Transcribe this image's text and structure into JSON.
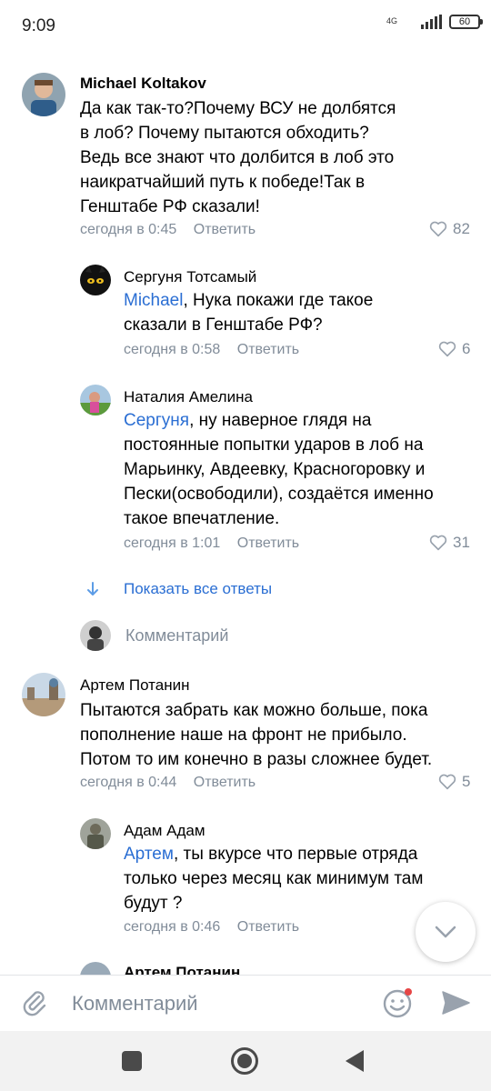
{
  "status_bar": {
    "time": "9:09",
    "network": "4G",
    "battery": "60"
  },
  "comments": [
    {
      "author": "Michael Koltakov",
      "lines": [
        "Да как так-то?Почему ВСУ не долбятся",
        "в лоб? Почему пытаются обходить?",
        "Ведь все знают что долбится в лоб это",
        "наикратчайший путь к победе!Так в",
        "Генштабе РФ сказали!"
      ],
      "time": "сегодня в 0:45",
      "reply_label": "Ответить",
      "likes": "82"
    },
    {
      "author": "Сергуня Тотсамый",
      "mention": "Michael",
      "lines": [
        ", Нука покажи где такое",
        "сказали в Генштабе РФ?"
      ],
      "time": "сегодня в 0:58",
      "reply_label": "Ответить",
      "likes": "6"
    },
    {
      "author": "Наталия Амелина",
      "mention": "Сергуня",
      "lines": [
        ", ну наверное глядя на",
        "постоянные попытки ударов в лоб на",
        "Марьинку, Авдеевку, Красногоровку и",
        "Пески(освободили), создаётся именно",
        "такое впечатление."
      ],
      "time": "сегодня в 1:01",
      "reply_label": "Ответить",
      "likes": "31"
    },
    {
      "author": "Артем Потанин",
      "lines": [
        "Пытаются забрать как можно больше, пока",
        "пополнение наше на фронт не прибыло.",
        "Потом то им конечно в разы сложнее будет."
      ],
      "time": "сегодня в 0:44",
      "reply_label": "Ответить",
      "likes": "5"
    },
    {
      "author": "Адам Адам",
      "mention": "Артем",
      "lines": [
        ", ты вкурсе что первые отряда",
        "только через месяц как минимум там",
        "будут ?"
      ],
      "time": "сегодня в 0:46",
      "reply_label": "Ответить",
      "likes": ""
    }
  ],
  "show_all_replies": "Показать все ответы",
  "inline_reply_placeholder": "Комментарий",
  "peek_next_author": "Артем Потанин",
  "composer": {
    "placeholder": "Комментарий"
  },
  "colors": {
    "link": "#2a6ed3",
    "muted": "#818c99",
    "send": "#99a2ad",
    "notification_dot": "#e64646"
  },
  "icons": [
    "paperclip-icon",
    "smile-icon",
    "send-icon",
    "heart-icon",
    "chevron-down-icon",
    "arrow-down-icon"
  ]
}
